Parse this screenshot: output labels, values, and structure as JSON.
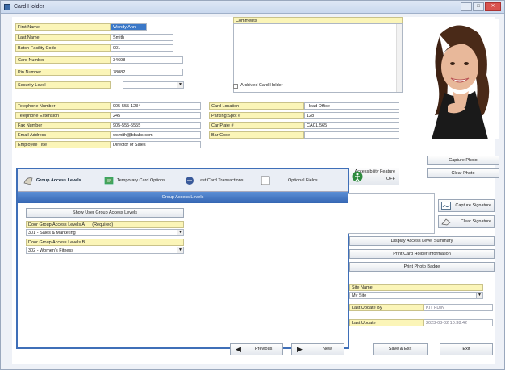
{
  "window": {
    "title": "Card Holder",
    "buttons": {
      "minimize": "—",
      "maximize": "□",
      "close": "✕"
    }
  },
  "fields": [
    {
      "label": "First Name",
      "value": "Wendy Ann",
      "selected": true
    },
    {
      "label": "Last Name",
      "value": "Smith"
    },
    {
      "label": "Batch-Facility Code",
      "value": "001"
    },
    {
      "label": "Card Number",
      "value": "34698"
    },
    {
      "label": "Pin Number",
      "value": "78082"
    },
    {
      "label": "Security Level",
      "value": ""
    }
  ],
  "comments": {
    "label": "Comments",
    "value": ""
  },
  "archived": {
    "label": "Archived Card Holder"
  },
  "contact_left": [
    {
      "label": "Telephone Number",
      "value": "905-555-1234"
    },
    {
      "label": "Telephone Extension",
      "value": "245"
    },
    {
      "label": "Fax Number",
      "value": "905-555-5555"
    },
    {
      "label": "Email Address",
      "value": "wsmith@bbabs.com"
    },
    {
      "label": "Employee Title",
      "value": "Director of Sales"
    }
  ],
  "contact_right": [
    {
      "label": "Card Location",
      "value": "Head Office"
    },
    {
      "label": "Parking Spot #",
      "value": "128"
    },
    {
      "label": "Car Plate #",
      "value": "CACL 565"
    },
    {
      "label": "Bar Code",
      "value": ""
    }
  ],
  "photo": {
    "capture": "Capture Photo",
    "clear": "Clear Photo"
  },
  "accessibility": {
    "label": "Accessibility Feature OFF"
  },
  "tabs": [
    {
      "label": "Group Access Levels",
      "active": true
    },
    {
      "label": "Temporary Card Options"
    },
    {
      "label": "Last Card Transactions"
    },
    {
      "label": "Optional Fields"
    }
  ],
  "group_access": {
    "header": "Group Access Levels",
    "show_button": "Show User Group Access Levels",
    "level_a_label": "Door Group Access Levels A",
    "level_a_required": "(Required)",
    "level_a_value": "301 - Sales & Marketing",
    "level_b_label": "Door Group Access Levels B",
    "level_b_value": "302 - Women's Fitness"
  },
  "signature": {
    "capture": "Capture Signature",
    "clear": "Clear Signature"
  },
  "action_buttons": {
    "summary": "Display Access Level Summary",
    "print_info": "Print Card Holder Information",
    "print_badge": "Print Photo Badge"
  },
  "site": {
    "label": "Site Name",
    "value": "My Site"
  },
  "last_update_by": {
    "label": "Last Update By",
    "value": "KIT FDIN"
  },
  "last_update": {
    "label": "Last Update",
    "value": "2023-03-02 10:38:42"
  },
  "nav": {
    "previous": "Previous",
    "next": "New",
    "save_exit": "Save & Exit",
    "exit": "Exit"
  }
}
